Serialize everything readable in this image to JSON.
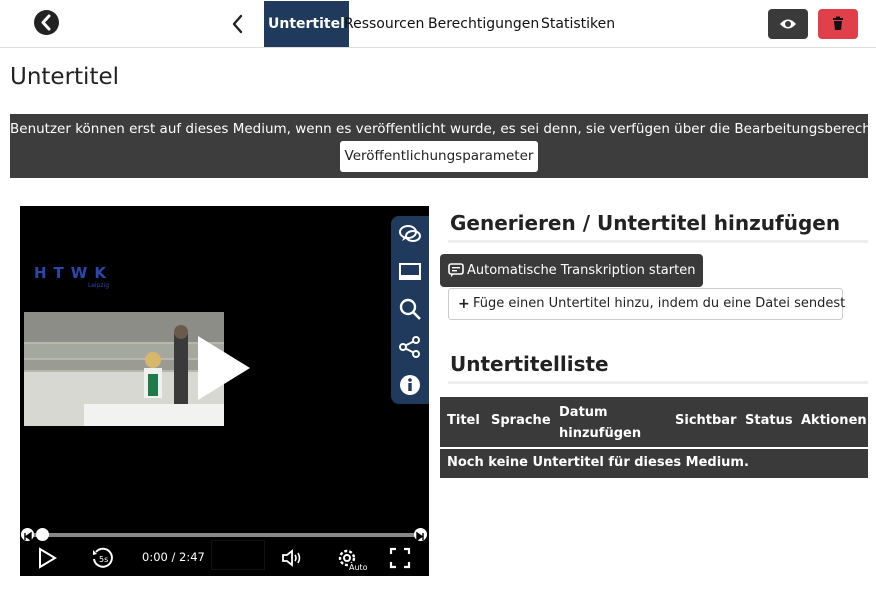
{
  "nav": {
    "tabs": [
      {
        "label": "Untertitel",
        "active": true
      },
      {
        "label": "Ressourcen",
        "active": false
      },
      {
        "label": "Berechtigungen",
        "active": false
      },
      {
        "label": "Statistiken",
        "active": false
      }
    ]
  },
  "page": {
    "title": "Untertitel"
  },
  "banner": {
    "text": "Benutzer können erst auf dieses Medium, wenn es veröffentlicht wurde, es sei denn, sie verfügen über die Bearbeitungsberechtigung.",
    "button_label": "Veröffentlichungsparameter"
  },
  "player": {
    "logo_text": "HTWK",
    "logo_subtext": "Leipzig",
    "time": "0:00 / 2:47",
    "quality_badge": "Auto",
    "progress": 0.0
  },
  "generate": {
    "heading": "Generieren / Untertitel hinzufügen",
    "transcription_button": "Automatische Transkription starten",
    "add_file_button": "Füge einen Untertitel hinzu, indem du eine Datei sendest"
  },
  "list": {
    "heading": "Untertitelliste",
    "columns": [
      "Titel",
      "Sprache",
      "Datum hinzufügen",
      "Sichtbar",
      "Status",
      "Aktionen"
    ],
    "empty_message": "Noch keine Untertitel für dieses Medium."
  },
  "colors": {
    "accent_navy": "#1f3a5c",
    "dark_panel": "#3a3a3a",
    "danger": "#e0404a"
  }
}
